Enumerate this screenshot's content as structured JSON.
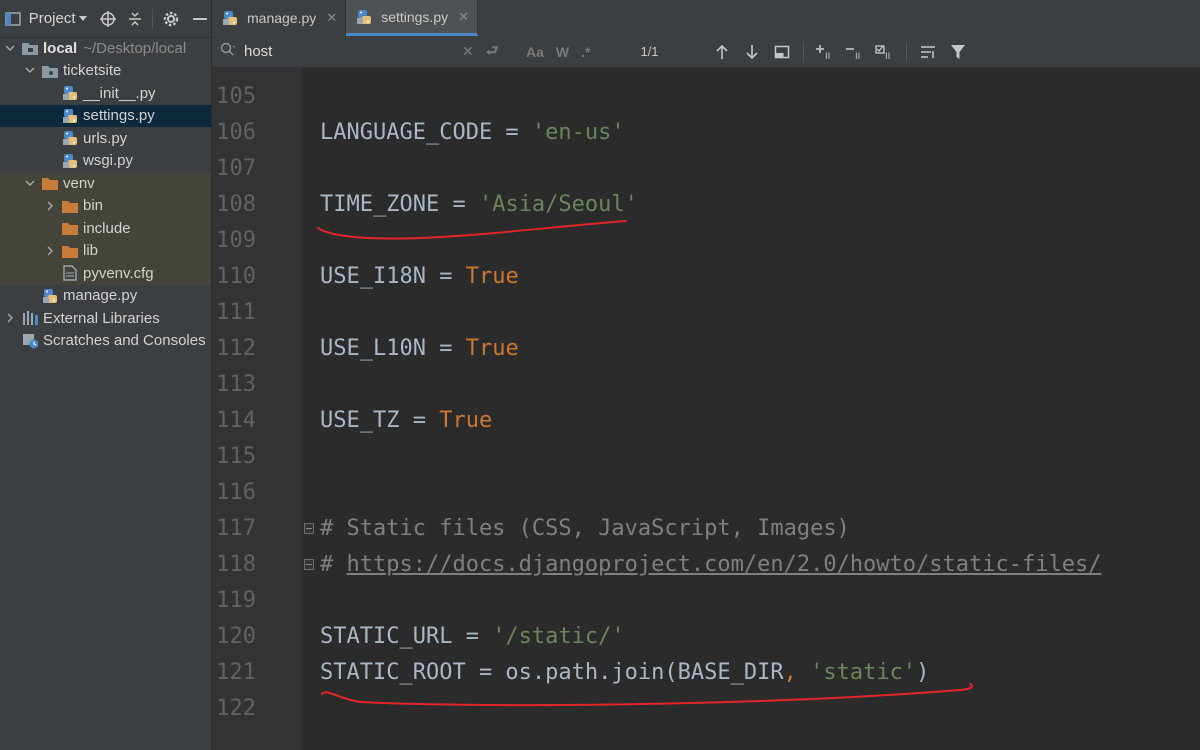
{
  "sidebar": {
    "title": "Project",
    "tree": [
      {
        "label": "local",
        "suffix": "~/Desktop/local",
        "type": "folder-module",
        "indent": 0,
        "expanded": true,
        "bold": true
      },
      {
        "label": "ticketsite",
        "type": "folder-package",
        "indent": 1,
        "expanded": true
      },
      {
        "label": "__init__.py",
        "type": "python-file",
        "indent": 2
      },
      {
        "label": "settings.py",
        "type": "python-file",
        "indent": 2,
        "selected": true
      },
      {
        "label": "urls.py",
        "type": "python-file",
        "indent": 2
      },
      {
        "label": "wsgi.py",
        "type": "python-file",
        "indent": 2
      },
      {
        "label": "venv",
        "type": "folder-orange",
        "indent": 1,
        "expanded": true
      },
      {
        "label": "bin",
        "type": "folder-orange",
        "indent": 2,
        "collapsed": true
      },
      {
        "label": "include",
        "type": "folder-orange",
        "indent": 2
      },
      {
        "label": "lib",
        "type": "folder-orange",
        "indent": 2,
        "collapsed": true
      },
      {
        "label": "pyvenv.cfg",
        "type": "text-file",
        "indent": 2
      },
      {
        "label": "manage.py",
        "type": "python-file",
        "indent": 1
      },
      {
        "label": "External Libraries",
        "type": "libraries",
        "indent": 0,
        "collapsed": true
      },
      {
        "label": "Scratches and Consoles",
        "type": "scratches",
        "indent": 0
      }
    ]
  },
  "tabs": [
    {
      "label": "manage.py",
      "active": false
    },
    {
      "label": "settings.py",
      "active": true
    }
  ],
  "search": {
    "value": "host",
    "match_count": "1/1",
    "case_label": "Aa",
    "word_label": "W",
    "regex_label": ".*"
  },
  "editor": {
    "lines": [
      {
        "n": "105",
        "tokens": []
      },
      {
        "n": "106",
        "tokens": [
          {
            "t": "LANGUAGE_CODE = "
          },
          {
            "t": "'en-us'",
            "c": "str"
          }
        ]
      },
      {
        "n": "107",
        "tokens": []
      },
      {
        "n": "108",
        "tokens": [
          {
            "t": "TIME_ZONE = "
          },
          {
            "t": "'Asia/Seoul'",
            "c": "str"
          }
        ]
      },
      {
        "n": "109",
        "tokens": []
      },
      {
        "n": "110",
        "tokens": [
          {
            "t": "USE_I18N = "
          },
          {
            "t": "True",
            "c": "kw"
          }
        ]
      },
      {
        "n": "111",
        "tokens": []
      },
      {
        "n": "112",
        "tokens": [
          {
            "t": "USE_L10N = "
          },
          {
            "t": "True",
            "c": "kw"
          }
        ]
      },
      {
        "n": "113",
        "tokens": []
      },
      {
        "n": "114",
        "tokens": [
          {
            "t": "USE_TZ = "
          },
          {
            "t": "True",
            "c": "kw"
          }
        ]
      },
      {
        "n": "115",
        "tokens": []
      },
      {
        "n": "116",
        "tokens": []
      },
      {
        "n": "117",
        "fold": true,
        "tokens": [
          {
            "t": "# Static files (CSS, JavaScript, Images)",
            "c": "cmt"
          }
        ]
      },
      {
        "n": "118",
        "fold": true,
        "tokens": [
          {
            "t": "# ",
            "c": "cmt"
          },
          {
            "t": "https://docs.djangoproject.com/en/2.0/howto/static-files/",
            "c": "link"
          }
        ]
      },
      {
        "n": "119",
        "tokens": []
      },
      {
        "n": "120",
        "tokens": [
          {
            "t": "STATIC_URL = "
          },
          {
            "t": "'/static/'",
            "c": "str"
          }
        ]
      },
      {
        "n": "121",
        "tokens": [
          {
            "t": "STATIC_ROOT = os.path.join(BASE_DIR"
          },
          {
            "t": ", ",
            "c": "kw"
          },
          {
            "t": "'static'",
            "c": "str"
          },
          {
            "t": ")"
          }
        ]
      },
      {
        "n": "122",
        "tokens": []
      }
    ]
  },
  "colors": {
    "annotation": "#e0262b",
    "string": "#6a8759",
    "keyword": "#cc7832",
    "comment": "#808080"
  }
}
